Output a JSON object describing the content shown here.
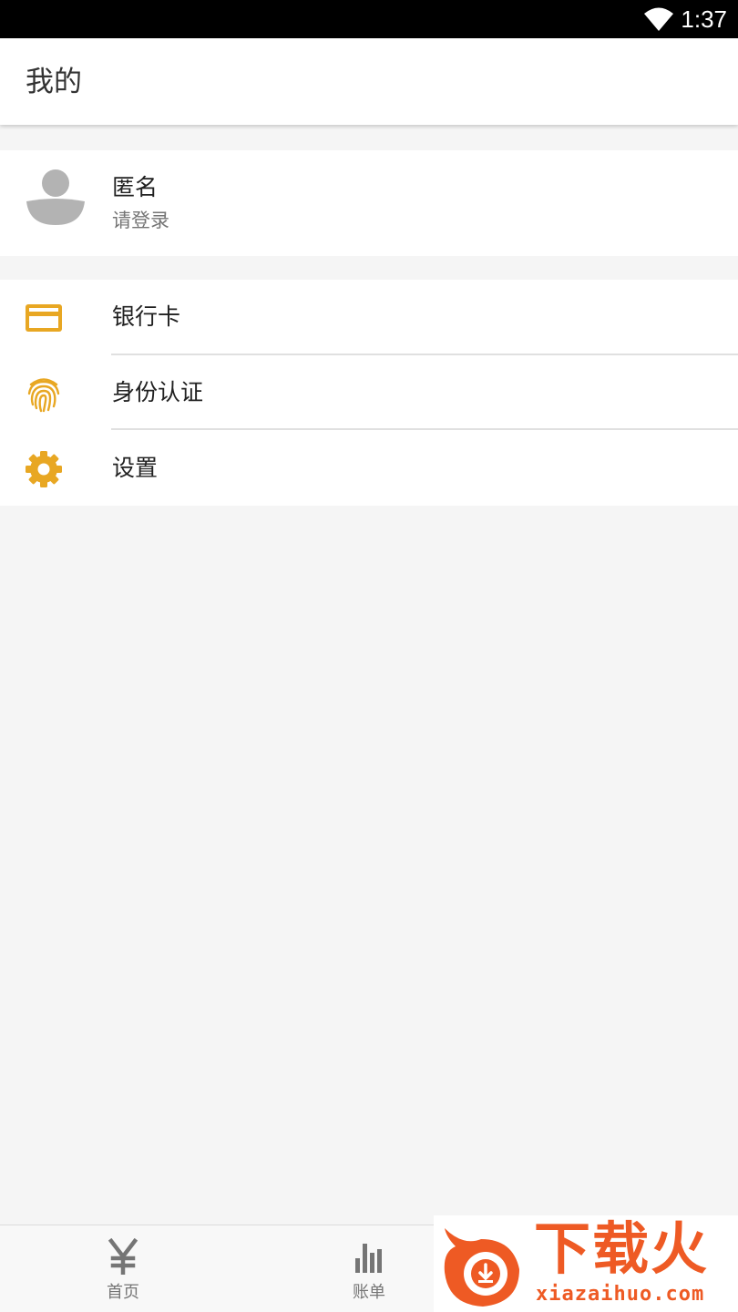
{
  "status_bar": {
    "time": "1:37",
    "wifi_icon": "wifi-icon"
  },
  "app_bar": {
    "title": "我的"
  },
  "profile": {
    "avatar_icon": "person-icon",
    "name": "匿名",
    "subtitle": "请登录"
  },
  "menu": {
    "items": [
      {
        "icon": "credit-card-icon",
        "label": "银行卡"
      },
      {
        "icon": "fingerprint-icon",
        "label": "身份认证"
      },
      {
        "icon": "gear-icon",
        "label": "设置"
      }
    ]
  },
  "bottom_nav": {
    "items": [
      {
        "icon": "yen-icon",
        "glyph": "¥",
        "label": "首页"
      },
      {
        "icon": "bar-chart-icon",
        "label": "账单"
      }
    ]
  },
  "watermark": {
    "text": "下载火",
    "url": "xiazaihuo.com"
  },
  "colors": {
    "accent": "#e8a723",
    "background": "#f5f5f5",
    "nav_icon": "#757575",
    "watermark": "#ee5a24"
  }
}
